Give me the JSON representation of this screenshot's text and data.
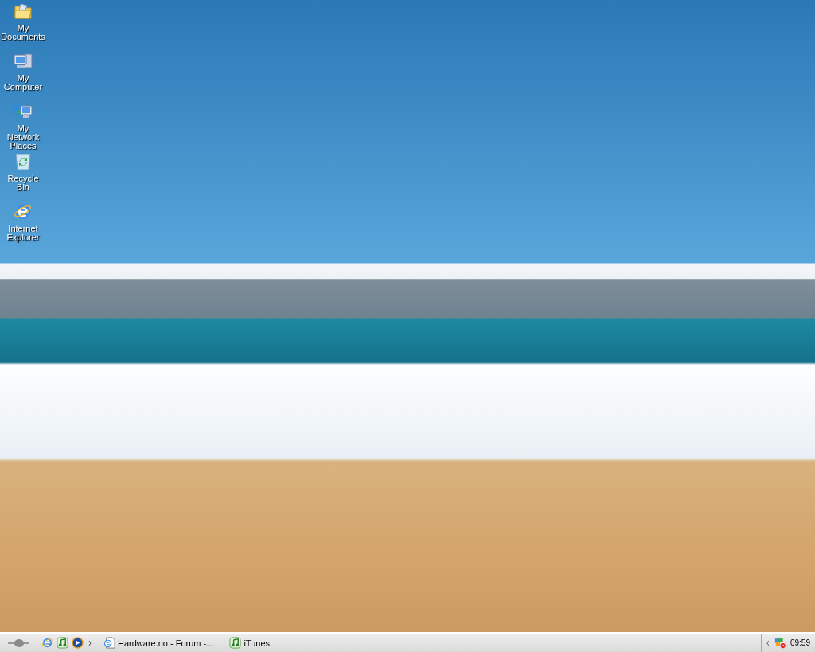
{
  "desktop_icons": [
    {
      "kind": "documents",
      "label": "My Documents"
    },
    {
      "kind": "computer",
      "label": "My Computer"
    },
    {
      "kind": "network",
      "label": "My Network Places"
    },
    {
      "kind": "recycle",
      "label": "Recycle Bin"
    },
    {
      "kind": "browser",
      "label": "Internet Explorer"
    }
  ],
  "taskbar": {
    "quick_launch": [
      {
        "kind": "browser"
      },
      {
        "kind": "music"
      },
      {
        "kind": "media"
      }
    ],
    "windows": [
      {
        "kind": "browser",
        "title": "Hardware.no - Forum -...",
        "selected": false
      },
      {
        "kind": "music",
        "title": "iTunes",
        "selected": false
      }
    ],
    "clock": "09:59"
  }
}
